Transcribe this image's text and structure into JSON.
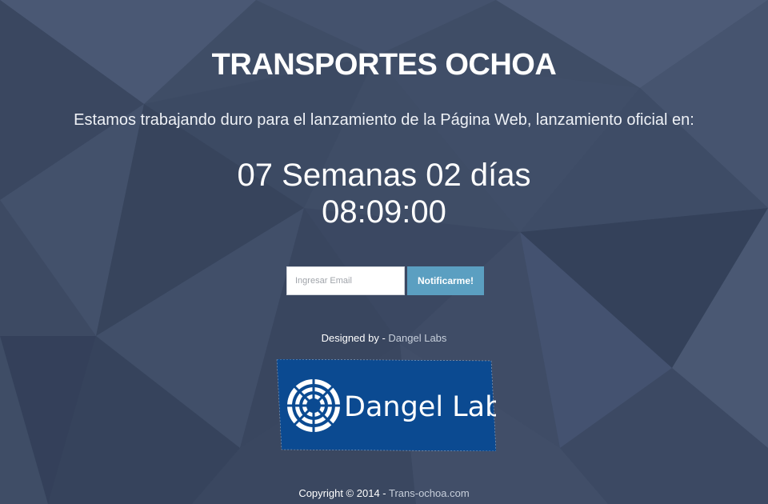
{
  "title": "TRANSPORTES OCHOA",
  "subtitle": "Estamos trabajando duro para el lanzamiento de la Página Web, lanzamiento oficial en:",
  "countdown": {
    "line1": "07 Semanas 02 días",
    "line2": "08:09:00"
  },
  "subscribe": {
    "email_placeholder": "Ingresar Email",
    "email_value": "",
    "button_label": "Notificarme!"
  },
  "credit": {
    "prefix": "Designed by - ",
    "link_text": "Dangel Labs"
  },
  "logo": {
    "text": "Dangel Labs",
    "icon": "dangel-labs-logo-icon",
    "background_color": "#0b4a91"
  },
  "footer": {
    "prefix": "Copyright © 2014 - ",
    "link_text": "Trans-ochoa.com"
  },
  "colors": {
    "background": "#3f4d66",
    "button": "#5b9fc1",
    "link": "#c7cfdb"
  }
}
